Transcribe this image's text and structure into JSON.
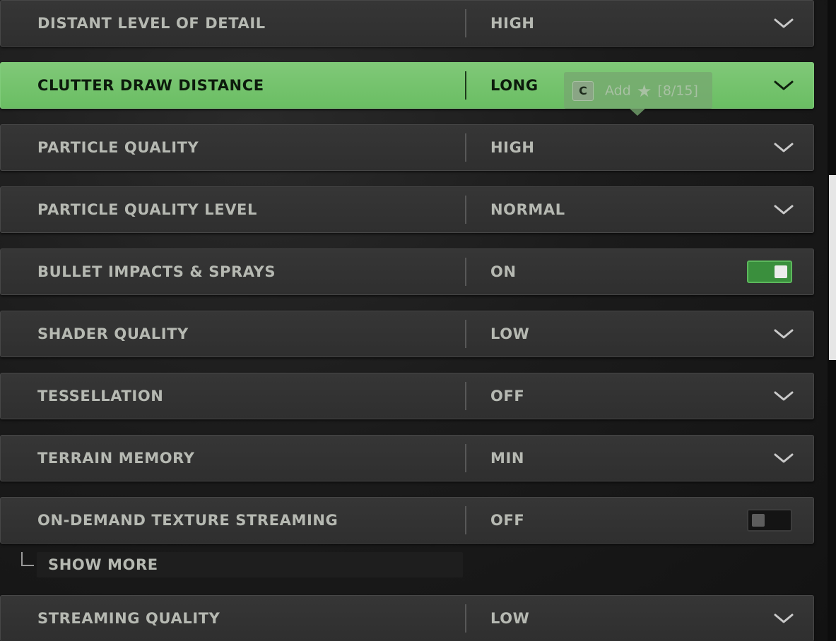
{
  "settings": [
    {
      "label": "DISTANT LEVEL OF DETAIL",
      "value": "HIGH",
      "control": "dropdown"
    },
    {
      "label": "CLUTTER DRAW DISTANCE",
      "value": "LONG",
      "control": "dropdown",
      "highlighted": true
    },
    {
      "label": "PARTICLE QUALITY",
      "value": "HIGH",
      "control": "dropdown"
    },
    {
      "label": "PARTICLE QUALITY LEVEL",
      "value": "NORMAL",
      "control": "dropdown"
    },
    {
      "label": "BULLET IMPACTS & SPRAYS",
      "value": "ON",
      "control": "toggle",
      "toggle_on": true
    },
    {
      "label": "SHADER QUALITY",
      "value": "LOW",
      "control": "dropdown"
    },
    {
      "label": "TESSELLATION",
      "value": "OFF",
      "control": "dropdown"
    },
    {
      "label": "TERRAIN MEMORY",
      "value": "MIN",
      "control": "dropdown"
    },
    {
      "label": "ON-DEMAND TEXTURE STREAMING",
      "value": "OFF",
      "control": "toggle",
      "toggle_on": false
    },
    {
      "label": "STREAMING QUALITY",
      "value": "LOW",
      "control": "dropdown"
    }
  ],
  "tooltip": {
    "key": "C",
    "text": "Add",
    "star": "★",
    "count": "[8/15]"
  },
  "show_more": {
    "label": "SHOW MORE"
  },
  "icons": {
    "dropdown": "chevron-down-icon",
    "favorite": "star-icon",
    "subitem": "corner-bracket-icon"
  },
  "colors": {
    "highlight": "#6abe63",
    "toggle_on": "#3a8f3d",
    "text": "#b6b9b2",
    "row_bg": "#333333"
  }
}
